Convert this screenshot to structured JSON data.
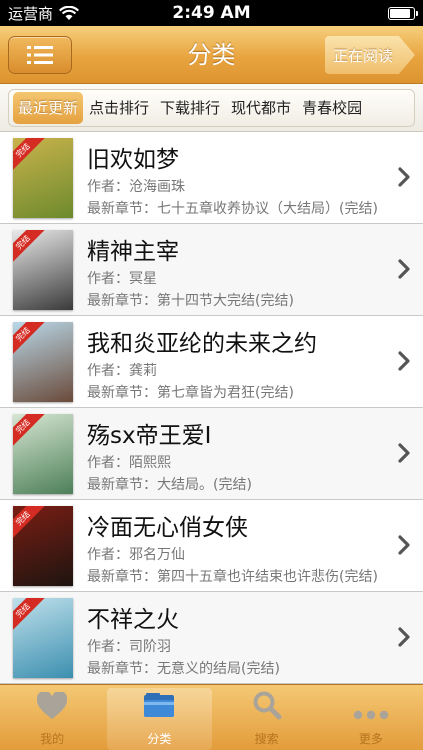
{
  "status_bar": {
    "carrier": "运营商",
    "time": "2:49 AM",
    "battery_level": 0.9
  },
  "nav": {
    "title": "分类",
    "right_button": "正在阅读",
    "menu_icon": "menu-list-icon"
  },
  "segments": [
    {
      "label": "最近更新",
      "active": true
    },
    {
      "label": "点击排行",
      "active": false
    },
    {
      "label": "下载排行",
      "active": false
    },
    {
      "label": "现代都市",
      "active": false
    },
    {
      "label": "青春校园",
      "active": false
    }
  ],
  "badge_text": "完结",
  "books": [
    {
      "title": "旧欢如梦",
      "author": "作者：沧海画珠",
      "latest": "最新章节：七十五章收养协议（大结局）(完结)",
      "cover_colors": [
        "#c9b34c",
        "#6d8a2d"
      ]
    },
    {
      "title": "精神主宰",
      "author": "作者：冥星",
      "latest": "最新章节：第十四节大完结(完结)",
      "cover_colors": [
        "#e9e9e9",
        "#3a3a3a"
      ]
    },
    {
      "title": "我和炎亚纶的未来之约",
      "author": "作者：龚莉",
      "latest": "最新章节：第七章皆为君狂(完结)",
      "cover_colors": [
        "#b9d8e8",
        "#6a4a3a"
      ]
    },
    {
      "title": "殇sx帝王爱I",
      "author": "作者：陌熙熙",
      "latest": "最新章节：大结局。(完结)",
      "cover_colors": [
        "#d6e6d2",
        "#4d7f59"
      ]
    },
    {
      "title": "冷面无心俏女侠",
      "author": "作者：邪名万仙",
      "latest": "最新章节：第四十五章也许结束也许悲伤(完结)",
      "cover_colors": [
        "#7a1e14",
        "#1e1410"
      ]
    },
    {
      "title": "不祥之火",
      "author": "作者：司阶羽",
      "latest": "最新章节：无意义的结局(完结)",
      "cover_colors": [
        "#bfe0ea",
        "#3c8fb0"
      ]
    }
  ],
  "tabs": [
    {
      "label": "我的",
      "icon": "heart-icon",
      "active": false
    },
    {
      "label": "分类",
      "icon": "folder-icon",
      "active": true
    },
    {
      "label": "搜索",
      "icon": "search-icon",
      "active": false
    },
    {
      "label": "更多",
      "icon": "more-dots-icon",
      "active": false
    }
  ],
  "colors": {
    "accent": "#e5a13f",
    "badge": "#d42b22",
    "tab_inactive": "#b6741e"
  }
}
